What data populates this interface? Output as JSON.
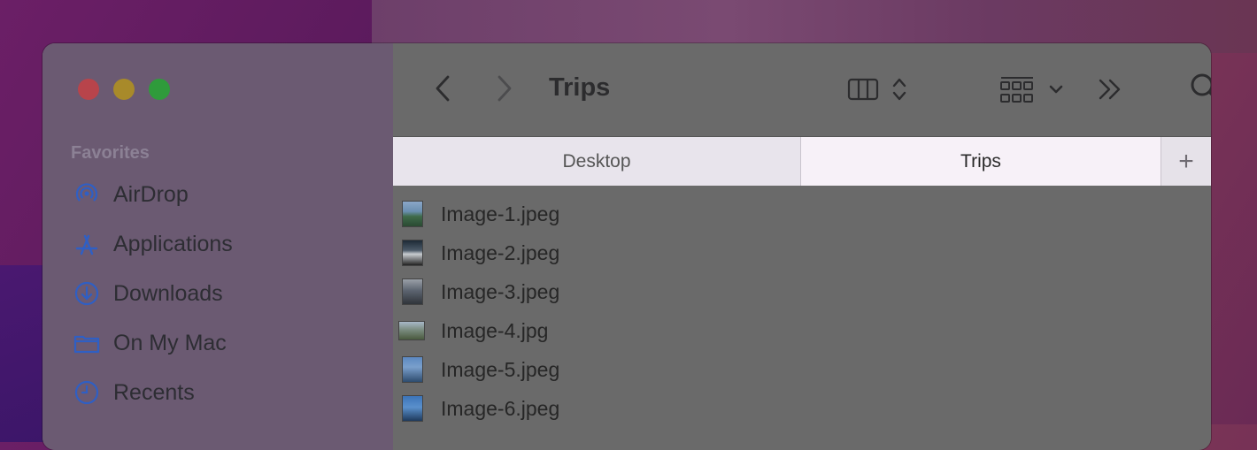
{
  "window": {
    "title": "Trips"
  },
  "sidebar": {
    "section_title": "Favorites",
    "items": [
      {
        "label": "AirDrop",
        "icon": "airdrop-icon"
      },
      {
        "label": "Applications",
        "icon": "applications-icon"
      },
      {
        "label": "Downloads",
        "icon": "downloads-icon"
      },
      {
        "label": "On My Mac",
        "icon": "folder-icon"
      },
      {
        "label": "Recents",
        "icon": "clock-icon"
      }
    ]
  },
  "tabs": [
    {
      "label": "Desktop",
      "active": false
    },
    {
      "label": "Trips",
      "active": true
    }
  ],
  "tab_add_label": "+",
  "files": [
    {
      "name": "Image-1.jpeg"
    },
    {
      "name": "Image-2.jpeg"
    },
    {
      "name": "Image-3.jpeg"
    },
    {
      "name": "Image-4.jpg"
    },
    {
      "name": "Image-5.jpeg"
    },
    {
      "name": "Image-6.jpeg"
    }
  ],
  "colors": {
    "accent": "#2f5fc4",
    "close": "#b8444b",
    "minimize": "#a88a2a",
    "maximize": "#2f9b3b"
  }
}
